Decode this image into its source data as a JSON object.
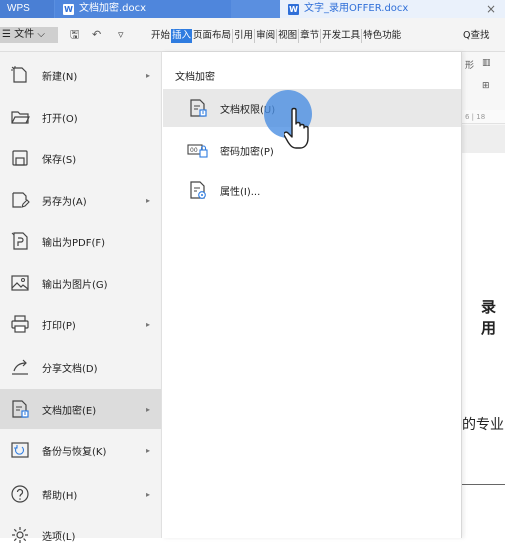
{
  "titlebar": {
    "app_label": "WPS",
    "tabs": [
      {
        "label": "文档加密.docx",
        "icon": "word-doc-icon"
      },
      {
        "label": "文字_录用OFFER.docx",
        "icon": "word-doc-icon"
      }
    ],
    "close_glyph": "×"
  },
  "ribbon": {
    "file_menu_label": "文件",
    "menu_tabs": [
      "开始",
      "插入",
      "页面布局",
      "引用",
      "审阅",
      "视图",
      "章节",
      "开发工具",
      "特色功能"
    ],
    "active_tab": "插入",
    "search_label": "Q查找"
  },
  "left_menu": {
    "items": [
      {
        "label": "新建(N)",
        "icon": "new-file-icon",
        "has_arrow": true
      },
      {
        "label": "打开(O)",
        "icon": "open-folder-icon",
        "has_arrow": false
      },
      {
        "label": "保存(S)",
        "icon": "save-icon",
        "has_arrow": false
      },
      {
        "label": "另存为(A)",
        "icon": "save-as-icon",
        "has_arrow": true
      },
      {
        "label": "输出为PDF(F)",
        "icon": "export-pdf-icon",
        "has_arrow": false
      },
      {
        "label": "输出为图片(G)",
        "icon": "export-image-icon",
        "has_arrow": false
      },
      {
        "label": "打印(P)",
        "icon": "print-icon",
        "has_arrow": true
      },
      {
        "label": "分享文档(D)",
        "icon": "share-icon",
        "has_arrow": false
      },
      {
        "label": "文档加密(E)",
        "icon": "doc-encrypt-icon",
        "has_arrow": true,
        "selected": true
      },
      {
        "label": "备份与恢复(K)",
        "icon": "backup-restore-icon",
        "has_arrow": true
      },
      {
        "label": "帮助(H)",
        "icon": "help-icon",
        "has_arrow": true
      },
      {
        "label": "选项(L)",
        "icon": "options-gear-icon",
        "has_arrow": false
      }
    ],
    "arrow_glyph": "▸"
  },
  "submenu": {
    "title": "文档加密",
    "items": [
      {
        "label": "文档权限(U)",
        "icon": "doc-permission-icon",
        "hovered": true
      },
      {
        "label": "密码加密(P)",
        "icon": "password-encrypt-icon"
      },
      {
        "label": "属性(I)...",
        "icon": "properties-icon"
      }
    ]
  },
  "document": {
    "ruler_text": "6 | 18",
    "heading_fragment": "录用",
    "body_fragment": "的专业"
  },
  "colors": {
    "tabbar": "#5a8fe0",
    "active_tab_bg": "#2f7ce0",
    "selected_item": "#dcdcdc",
    "hover_item": "#e8e8e8",
    "cursor_halo": "#478ce1"
  }
}
